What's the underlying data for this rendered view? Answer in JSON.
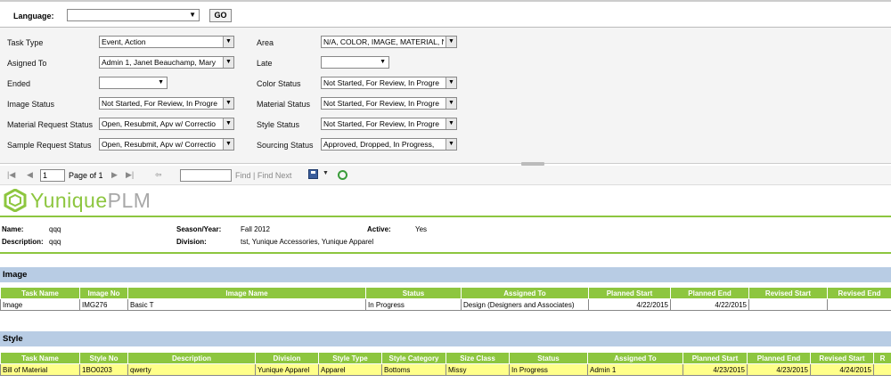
{
  "language_bar": {
    "label": "Language:",
    "value": "",
    "go_label": "GO"
  },
  "filters": {
    "left": [
      {
        "label": "Task Type",
        "value": "Event, Action"
      },
      {
        "label": "Asigned To",
        "value": "Admin 1, Janet Beauchamp, Mary"
      },
      {
        "label": "Ended",
        "value": ""
      },
      {
        "label": "Image Status",
        "value": "Not Started, For Review, In Progre"
      },
      {
        "label": "Material Request Status",
        "value": "Open, Resubmit, Apv w/ Correctio"
      },
      {
        "label": "Sample Request Status",
        "value": "Open, Resubmit, Apv w/ Correctio"
      }
    ],
    "right": [
      {
        "label": "Area",
        "value": "N/A, COLOR, IMAGE, MATERIAL, N"
      },
      {
        "label": "Late",
        "value": ""
      },
      {
        "label": "Color Status",
        "value": "Not Started, For Review, In Progre"
      },
      {
        "label": "Material Status",
        "value": "Not Started, For Review, In Progre"
      },
      {
        "label": "Style Status",
        "value": "Not Started, For Review, In Progre"
      },
      {
        "label": "Sourcing Status",
        "value": "Approved, Dropped, In Progress,"
      }
    ]
  },
  "toolbar": {
    "page_value": "1",
    "page_of": "Page of 1",
    "find_label": "Find",
    "separator": "|",
    "find_next_label": "Find Next"
  },
  "logo": {
    "brand": "Yunique",
    "suffix": "PLM"
  },
  "info": {
    "name_label": "Name:",
    "name_value": "qqq",
    "description_label": "Description:",
    "description_value": "qqq",
    "season_label": "Season/Year:",
    "season_value": "Fall 2012",
    "division_label": "Division:",
    "division_value": "tst, Yunique Accessories, Yunique Apparel",
    "active_label": "Active:",
    "active_value": "Yes"
  },
  "image_section": {
    "title": "Image",
    "columns": [
      "Task Name",
      "Image No",
      "Image Name",
      "Status",
      "Assigned To",
      "Planned Start",
      "Planned End",
      "Revised Start",
      "Revised End"
    ],
    "rows": [
      [
        "Image",
        "IMG276",
        "Basic T",
        "In Progress",
        "Design (Designers and Associates)",
        "4/22/2015",
        "4/22/2015",
        "",
        ""
      ]
    ]
  },
  "style_section": {
    "title": "Style",
    "columns": [
      "Task Name",
      "Style No",
      "Description",
      "Division",
      "Style Type",
      "Style Category",
      "Size Class",
      "Status",
      "Assigned To",
      "Planned Start",
      "Planned End",
      "Revised Start",
      "R"
    ],
    "rows": [
      [
        "Bill of Material",
        "1BO0203",
        "qwerty",
        "Yunique Apparel",
        "Apparel",
        "Bottoms",
        "Missy",
        "In Progress",
        "Admin 1",
        "4/23/2015",
        "4/23/2015",
        "4/24/2015",
        ""
      ]
    ]
  },
  "colors": {
    "accent_green": "#8dc63f",
    "section_blue": "#b8cce4",
    "highlight_yellow": "#ffff8a"
  }
}
